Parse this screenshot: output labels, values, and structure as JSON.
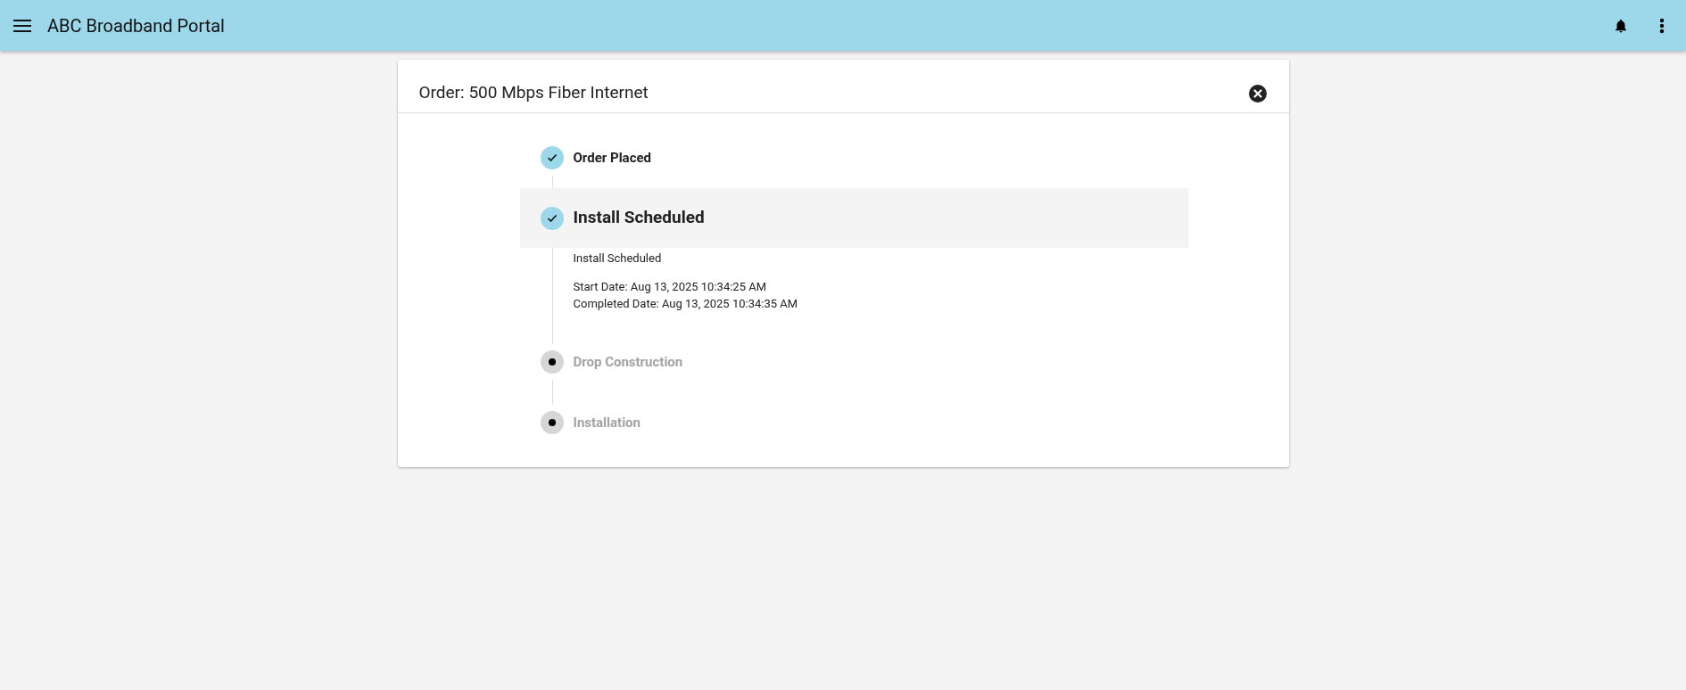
{
  "app_bar": {
    "title": "ABC Broadband Portal"
  },
  "order_card": {
    "title": "Order: 500 Mbps Fiber Internet",
    "steps": [
      {
        "label": "Order Placed",
        "completed": true,
        "selected": false
      },
      {
        "label": "Install Scheduled",
        "completed": true,
        "selected": true,
        "details": {
          "summary": "Install Scheduled",
          "lines": [
            "Start Date: Aug 13, 2025 10:34:25 AM",
            "Completed Date: Aug 13, 2025 10:34:35 AM"
          ]
        }
      },
      {
        "label": "Drop Construction",
        "completed": false,
        "selected": false
      },
      {
        "label": "Installation",
        "completed": false,
        "selected": false
      }
    ]
  }
}
